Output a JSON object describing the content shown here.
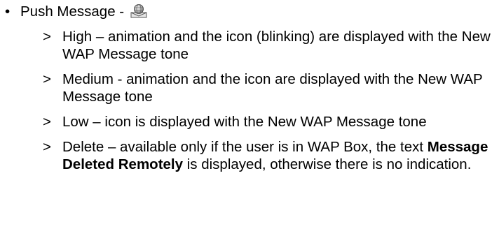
{
  "bullet": {
    "symbol": "•",
    "text": "Push Message - ",
    "icon": "push-message-envelope-globe-icon"
  },
  "sub_marker": ">",
  "items": [
    {
      "text": "High – animation and the icon (blinking) are displayed with the New WAP Message tone"
    },
    {
      "text": "Medium - animation and the icon are displayed with the New WAP Message tone"
    },
    {
      "text": "Low – icon is displayed with the New WAP Message tone"
    },
    {
      "text_before": "Delete – available only if the user is in WAP Box, the text ",
      "bold": "Message Deleted Remotely",
      "text_after": " is displayed, otherwise there is no indication."
    }
  ]
}
